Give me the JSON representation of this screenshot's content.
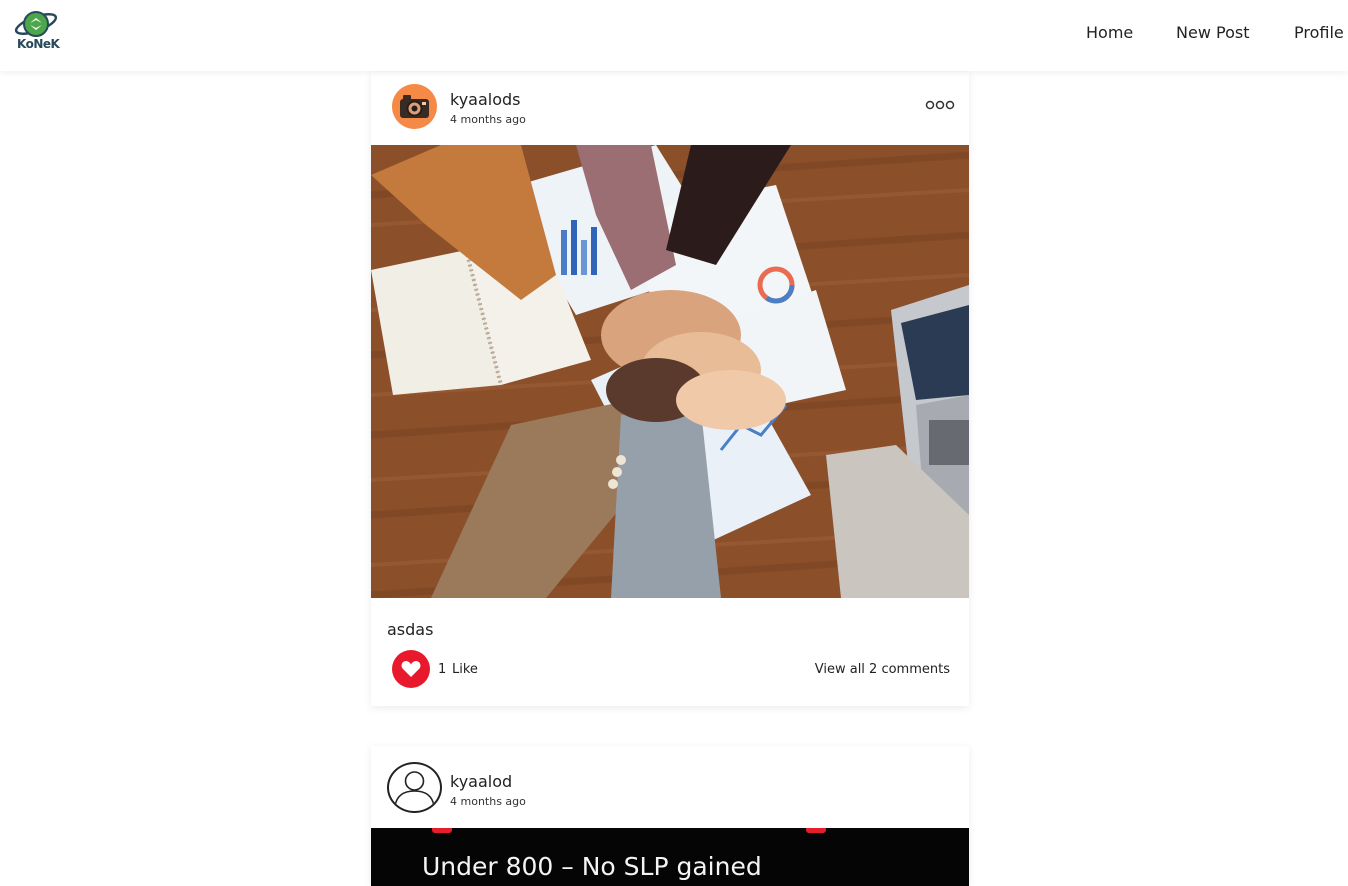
{
  "header": {
    "logo_text": "KoNeK",
    "nav": [
      "Home",
      "New Post",
      "Profile"
    ]
  },
  "posts": [
    {
      "username": "kyaalods",
      "time": "4 months ago",
      "avatar": "camera-avatar",
      "more_icon": "more-options-icon",
      "photo": "teamwork-hands-photo",
      "caption": "asdas",
      "like_count": "1",
      "like_label": "Like",
      "comments_link": "View all 2 comments"
    },
    {
      "username": "kyaalod",
      "time": "4 months ago",
      "avatar": "default-user-avatar",
      "photo_text": "Under 800 – No SLP gained"
    }
  ],
  "colors": {
    "accent": "#e8192c",
    "avatar_orange": "#f58a47",
    "logo_dark": "#27495a",
    "logo_green": "#4ca64a"
  }
}
